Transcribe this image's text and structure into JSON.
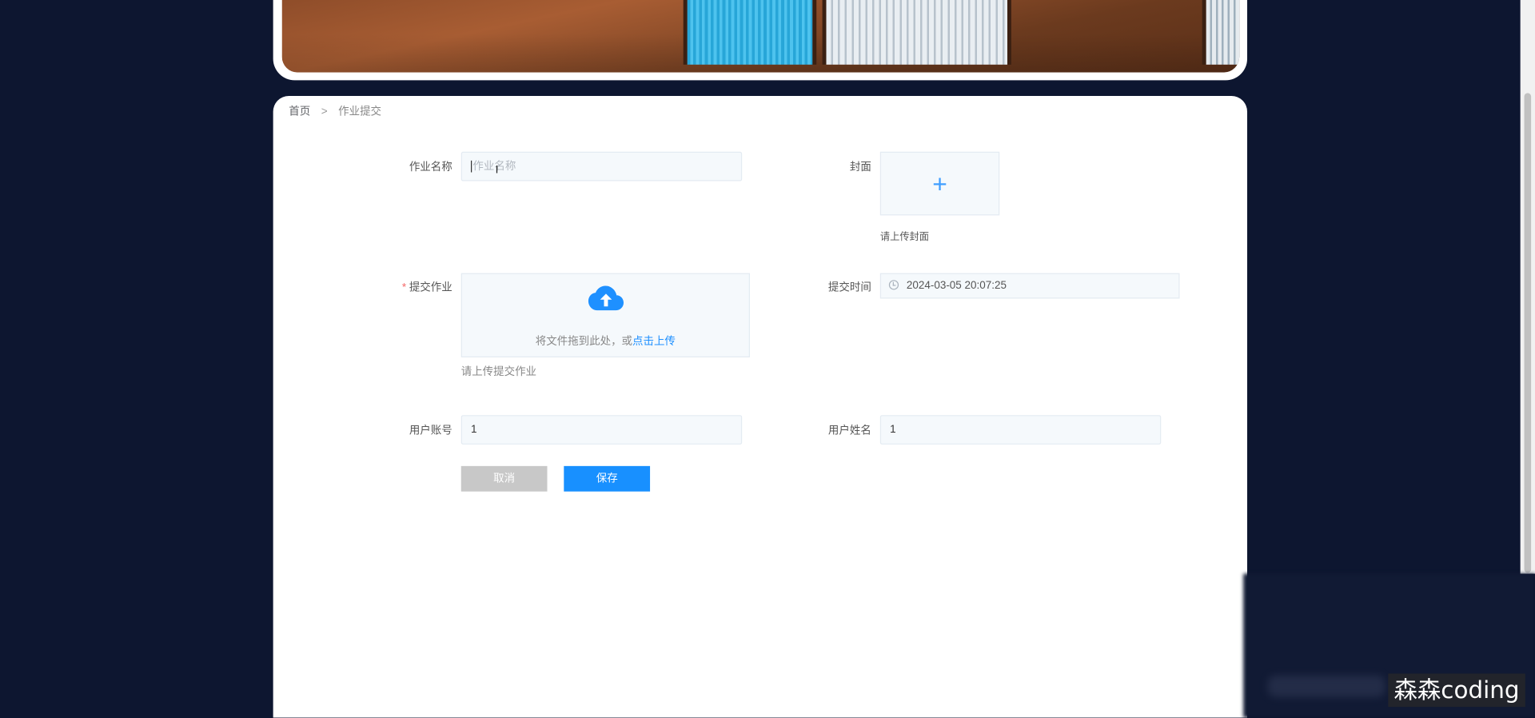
{
  "breadcrumb": {
    "home": "首页",
    "separator": ">",
    "current": "作业提交"
  },
  "form": {
    "work_name": {
      "label": "作业名称",
      "placeholder": "作业名称"
    },
    "cover": {
      "label": "封面",
      "hint": "请上传封面"
    },
    "submit_work": {
      "label": "提交作业",
      "required_mark": "*",
      "drop_text": "将文件拖到此处，或",
      "drop_link": "点击上传",
      "hint": "请上传提交作业"
    },
    "submit_time": {
      "label": "提交时间",
      "value": "2024-03-05 20:07:25"
    },
    "user_account": {
      "label": "用户账号",
      "value": "1"
    },
    "user_name": {
      "label": "用户姓名",
      "value": "1"
    }
  },
  "buttons": {
    "cancel": "取消",
    "save": "保存"
  },
  "watermark": "森森coding",
  "colors": {
    "page_bg": "#0d1630",
    "primary": "#1890ff",
    "cancel_bg": "#c8c8c8",
    "required": "#f56c6c"
  }
}
